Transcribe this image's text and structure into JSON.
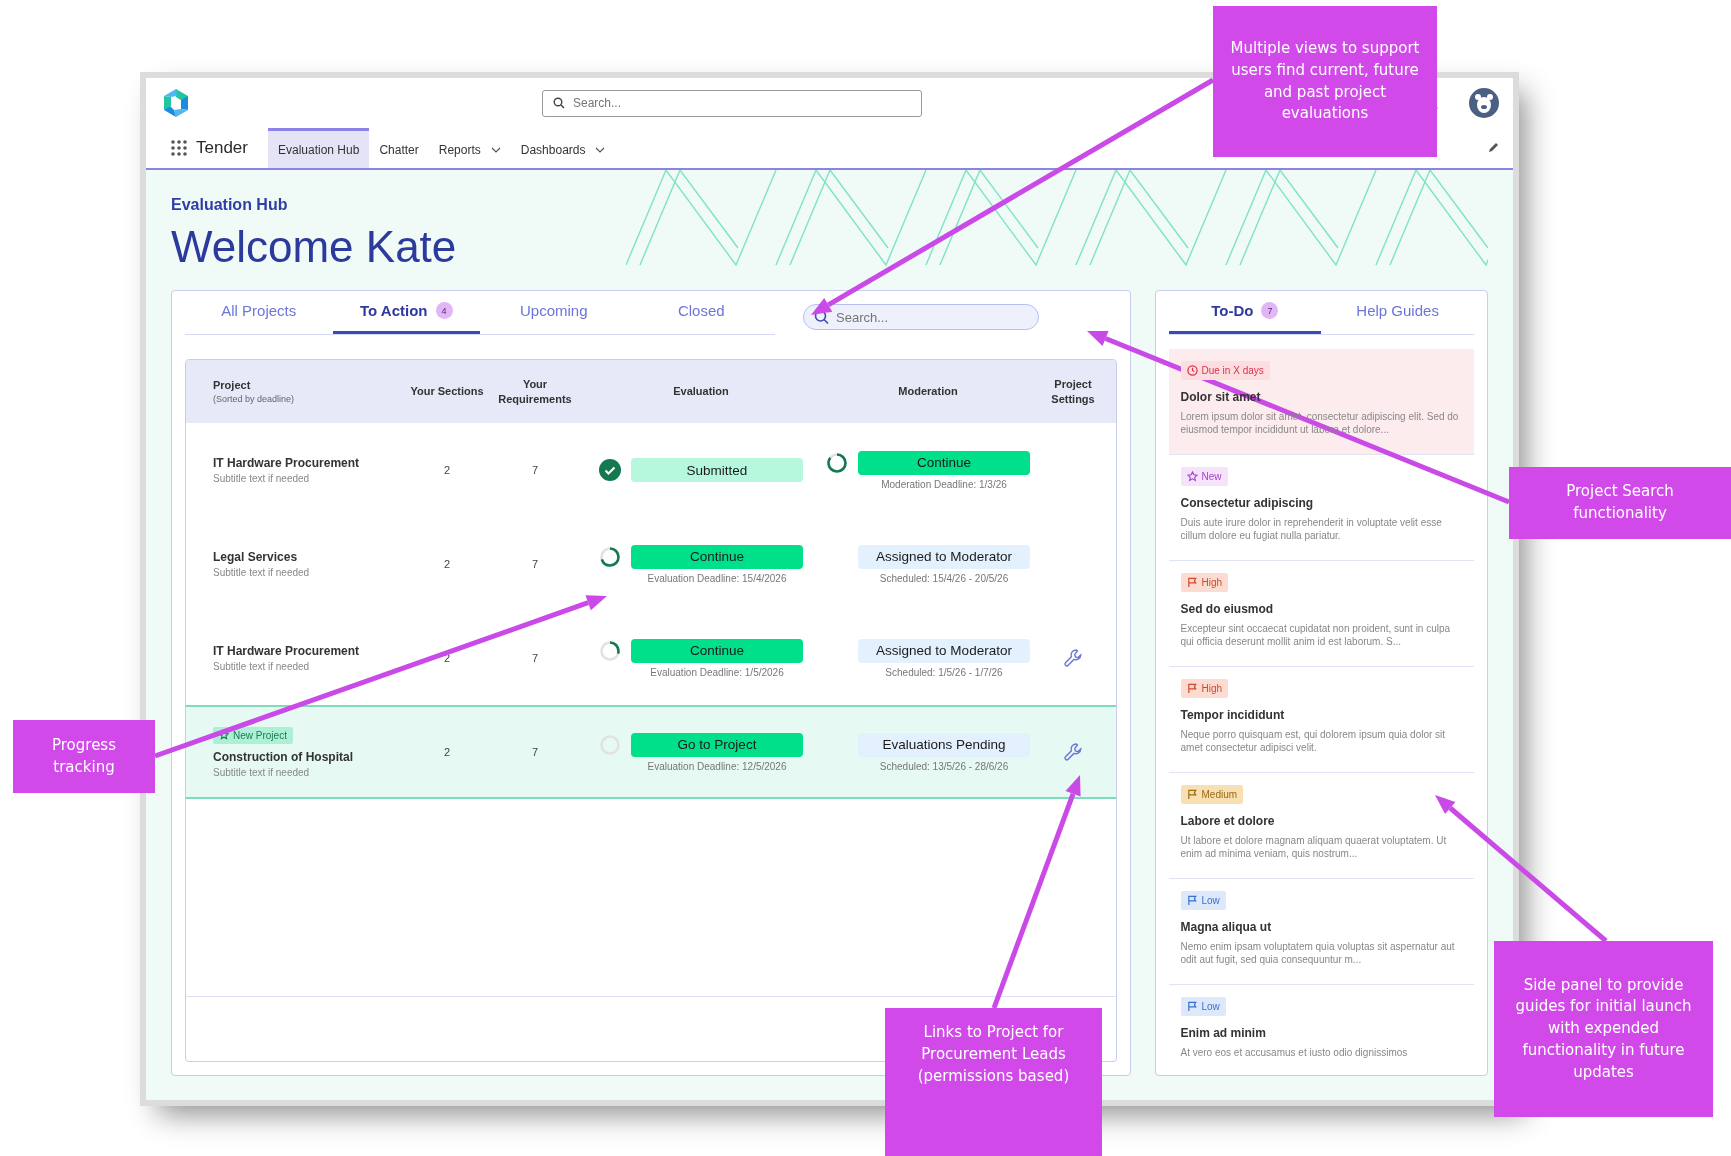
{
  "app_header": {
    "app_name": "Tender",
    "search": {
      "placeholder": "Search..."
    },
    "nav": [
      {
        "label": "Evaluation Hub",
        "selected": true,
        "dropdown": false
      },
      {
        "label": "Chatter",
        "selected": false,
        "dropdown": false
      },
      {
        "label": "Reports",
        "selected": false,
        "dropdown": true
      },
      {
        "label": "Dashboards",
        "selected": false,
        "dropdown": true
      }
    ]
  },
  "page": {
    "breadcrumb": "Evaluation Hub",
    "title": "Welcome Kate"
  },
  "project_tabs": [
    {
      "label": "All Projects",
      "selected": false
    },
    {
      "label": "To Action",
      "selected": true,
      "count": "4"
    },
    {
      "label": "Upcoming",
      "selected": false
    },
    {
      "label": "Closed",
      "selected": false
    }
  ],
  "project_search": {
    "placeholder": "Search..."
  },
  "table": {
    "columns": [
      {
        "title": "Project",
        "subtitle": "(Sorted by deadline)"
      },
      {
        "title": "Your Sections"
      },
      {
        "title": "Your Requirements"
      },
      {
        "title": "Evaluation"
      },
      {
        "title": "Moderation"
      },
      {
        "title": "Project Settings"
      }
    ],
    "rows": [
      {
        "highlighted": false,
        "project": "IT Hardware Procurement",
        "subtitle": "Subtitle text if needed",
        "sections": "2",
        "requirements": "7",
        "evaluation": {
          "progress": {
            "kind": "done"
          },
          "label": "Submitted",
          "kind": "status"
        },
        "moderation": {
          "progress": {
            "kind": "nearly"
          },
          "label": "Continue",
          "kind": "action",
          "note": "Moderation Deadline: 1/3/26"
        },
        "settings": false
      },
      {
        "highlighted": false,
        "project": "Legal Services",
        "subtitle": "Subtitle text if needed",
        "sections": "2",
        "requirements": "7",
        "evaluation": {
          "progress": {
            "kind": "most"
          },
          "label": "Continue",
          "kind": "action",
          "note": "Evaluation Deadline: 15/4/2026"
        },
        "moderation": {
          "label": "Assigned to Moderator",
          "kind": "info",
          "note": "Scheduled: 15/4/26 - 20/5/26"
        },
        "settings": false
      },
      {
        "highlighted": false,
        "project": "IT Hardware Procurement",
        "subtitle": "Subtitle text if needed",
        "sections": "2",
        "requirements": "7",
        "evaluation": {
          "progress": {
            "kind": "started"
          },
          "label": "Continue",
          "kind": "action",
          "note": "Evaluation Deadline: 1/5/2026"
        },
        "moderation": {
          "label": "Assigned to Moderator",
          "kind": "info",
          "note": "Scheduled: 1/5/26 - 1/7/26"
        },
        "settings": true
      },
      {
        "highlighted": true,
        "badge": "New Project",
        "project": "Construction of Hospital",
        "subtitle": "Subtitle text if needed",
        "sections": "2",
        "requirements": "7",
        "evaluation": {
          "progress": {
            "kind": "none"
          },
          "label": "Go to Project",
          "kind": "action",
          "note": "Evaluation Deadline: 12/5/2026"
        },
        "moderation": {
          "label": "Evaluations Pending",
          "kind": "info",
          "note": "Scheduled: 13/5/26 - 28/6/26"
        },
        "settings": true
      }
    ]
  },
  "side_tabs": [
    {
      "label": "To-Do",
      "selected": true,
      "count": "7"
    },
    {
      "label": "Help Guides",
      "selected": false
    }
  ],
  "todo_items": [
    {
      "kind": "due",
      "tag": "Due in X days",
      "title": "Dolor sit amet",
      "text": "Lorem ipsum dolor sit amet, consectetur adipiscing elit. Sed do eiusmod tempor incididunt ut labore et dolore..."
    },
    {
      "kind": "new",
      "tag": "New",
      "title": "Consectetur adipiscing",
      "text": "Duis aute irure dolor in reprehenderit in voluptate velit esse cillum dolore eu fugiat nulla pariatur."
    },
    {
      "kind": "high",
      "tag": "High",
      "title": "Sed do eiusmod",
      "text": "Excepteur sint occaecat cupidatat non proident, sunt in culpa qui officia deserunt mollit anim id est laborum. S..."
    },
    {
      "kind": "high",
      "tag": "High",
      "title": "Tempor incididunt",
      "text": "Neque porro quisquam est, qui dolorem ipsum quia dolor sit amet consectetur adipisci velit."
    },
    {
      "kind": "medium",
      "tag": "Medium",
      "title": "Labore et dolore",
      "text": "Ut labore et dolore magnam aliquam quaerat voluptatem. Ut enim ad minima veniam, quis nostrum..."
    },
    {
      "kind": "low",
      "tag": "Low",
      "title": "Magna aliqua ut",
      "text": "Nemo enim ipsam voluptatem quia voluptas sit aspernatur aut odit aut fugit, sed quia consequuntur m..."
    },
    {
      "kind": "low",
      "tag": "Low",
      "title": "Enim ad minim",
      "text": "At vero eos et accusamus et iusto odio dignissimos"
    }
  ],
  "annotations": [
    {
      "text": "Multiple views to support users find current, future and past project evaluations"
    },
    {
      "text": "Project Search functionality"
    },
    {
      "text": "Progress tracking"
    },
    {
      "text": "Links to Project for Procurement Leads (permissions based)"
    },
    {
      "text": "Side panel to provide guides for initial launch with expended functionality in future updates"
    }
  ]
}
